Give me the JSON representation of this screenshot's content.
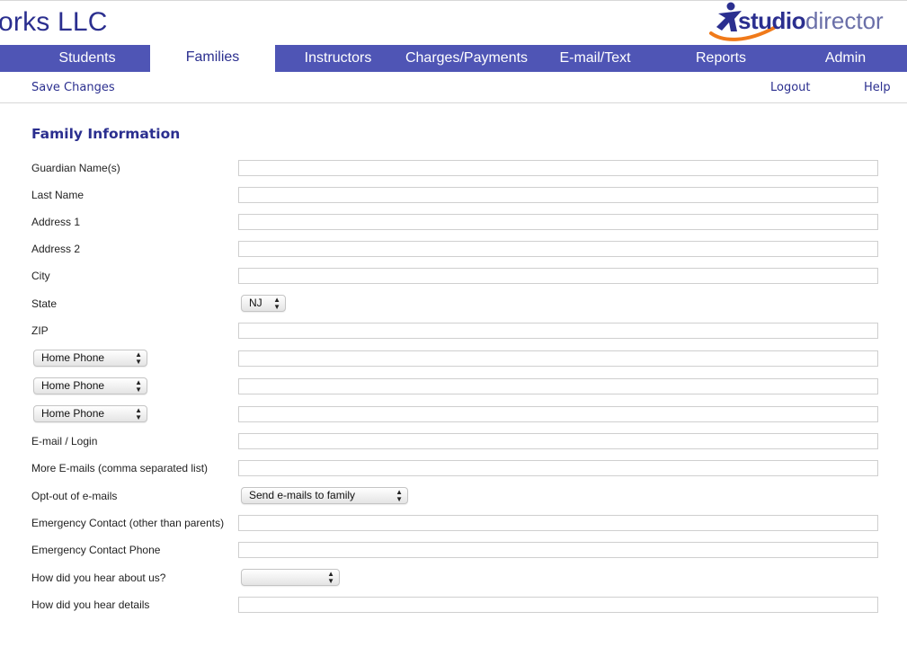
{
  "header": {
    "company_name": "orks LLC",
    "logo_studio": "studio",
    "logo_director": "director"
  },
  "nav": {
    "tabs": [
      {
        "label": "Students"
      },
      {
        "label": "Families",
        "active": true
      },
      {
        "label": "Instructors"
      },
      {
        "label": "Charges/Payments"
      },
      {
        "label": "E-mail/Text"
      },
      {
        "label": "Reports"
      },
      {
        "label": "Admin"
      }
    ]
  },
  "subbar": {
    "save_changes": "Save Changes",
    "logout": "Logout",
    "help": "Help"
  },
  "form": {
    "title": "Family Information",
    "labels": {
      "guardian_name": "Guardian Name(s)",
      "last_name": "Last Name",
      "address1": "Address 1",
      "address2": "Address 2",
      "city": "City",
      "state": "State",
      "zip": "ZIP",
      "email_login": "E-mail / Login",
      "more_emails": "More E-mails (comma separated list)",
      "opt_out": "Opt-out of e-mails",
      "emergency_contact": "Emergency Contact (other than parents)",
      "emergency_phone": "Emergency Contact Phone",
      "hear_about": "How did you hear about us?",
      "hear_details": "How did you hear details"
    },
    "values": {
      "guardian_name": "",
      "last_name": "",
      "address1": "",
      "address2": "",
      "city": "",
      "zip": "",
      "phone1": "",
      "phone2": "",
      "phone3": "",
      "email_login": "",
      "more_emails": "",
      "emergency_contact": "",
      "emergency_phone": "",
      "hear_details": ""
    },
    "selects": {
      "state": "NJ",
      "phone1_type": "Home Phone",
      "phone2_type": "Home Phone",
      "phone3_type": "Home Phone",
      "opt_out": "Send e-mails to family",
      "hear_about": ""
    }
  },
  "colors": {
    "brand_navy": "#2b2f8f",
    "nav_bar": "#4f55b5",
    "logo_orange": "#f07a1a"
  }
}
